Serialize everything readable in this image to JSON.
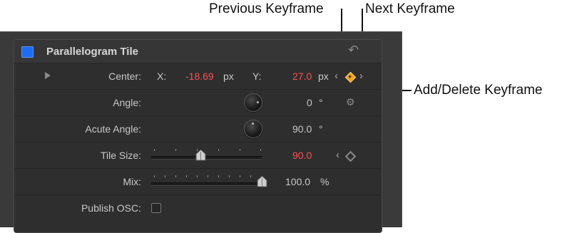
{
  "callouts": {
    "previous_keyframe": "Previous Keyframe",
    "next_keyframe": "Next Keyframe",
    "add_delete_keyframe": "Add/Delete Keyframe"
  },
  "panel": {
    "title": "Parallelogram Tile",
    "header_enabled": true,
    "reset_icon": "reset-arrow-icon"
  },
  "rows": {
    "center": {
      "label": "Center:",
      "x_label": "X:",
      "x_value": "-18.69",
      "x_unit": "px",
      "y_label": "Y:",
      "y_value": "27.0",
      "y_unit": "px"
    },
    "angle": {
      "label": "Angle:",
      "value": "0",
      "unit": "°"
    },
    "acute_angle": {
      "label": "Acute Angle:",
      "value": "90.0",
      "unit": "°"
    },
    "tile_size": {
      "label": "Tile Size:",
      "value": "90.0",
      "slider_fraction": 0.45
    },
    "mix": {
      "label": "Mix:",
      "value": "100.0",
      "unit": "%",
      "slider_fraction": 1.0
    },
    "publish_osc": {
      "label": "Publish OSC:",
      "checked": false
    }
  },
  "colors": {
    "accent_blue": "#1f6cf2",
    "animated_red": "#ff4f4f",
    "keyframe_orange": "#f0a020",
    "panel_bg": "#2e2e2e"
  },
  "icons": [
    "reset-arrow-icon",
    "expand-triangle-icon",
    "gear-icon",
    "previous-keyframe-icon",
    "next-keyframe-icon",
    "keyframe-diamond-icon"
  ]
}
